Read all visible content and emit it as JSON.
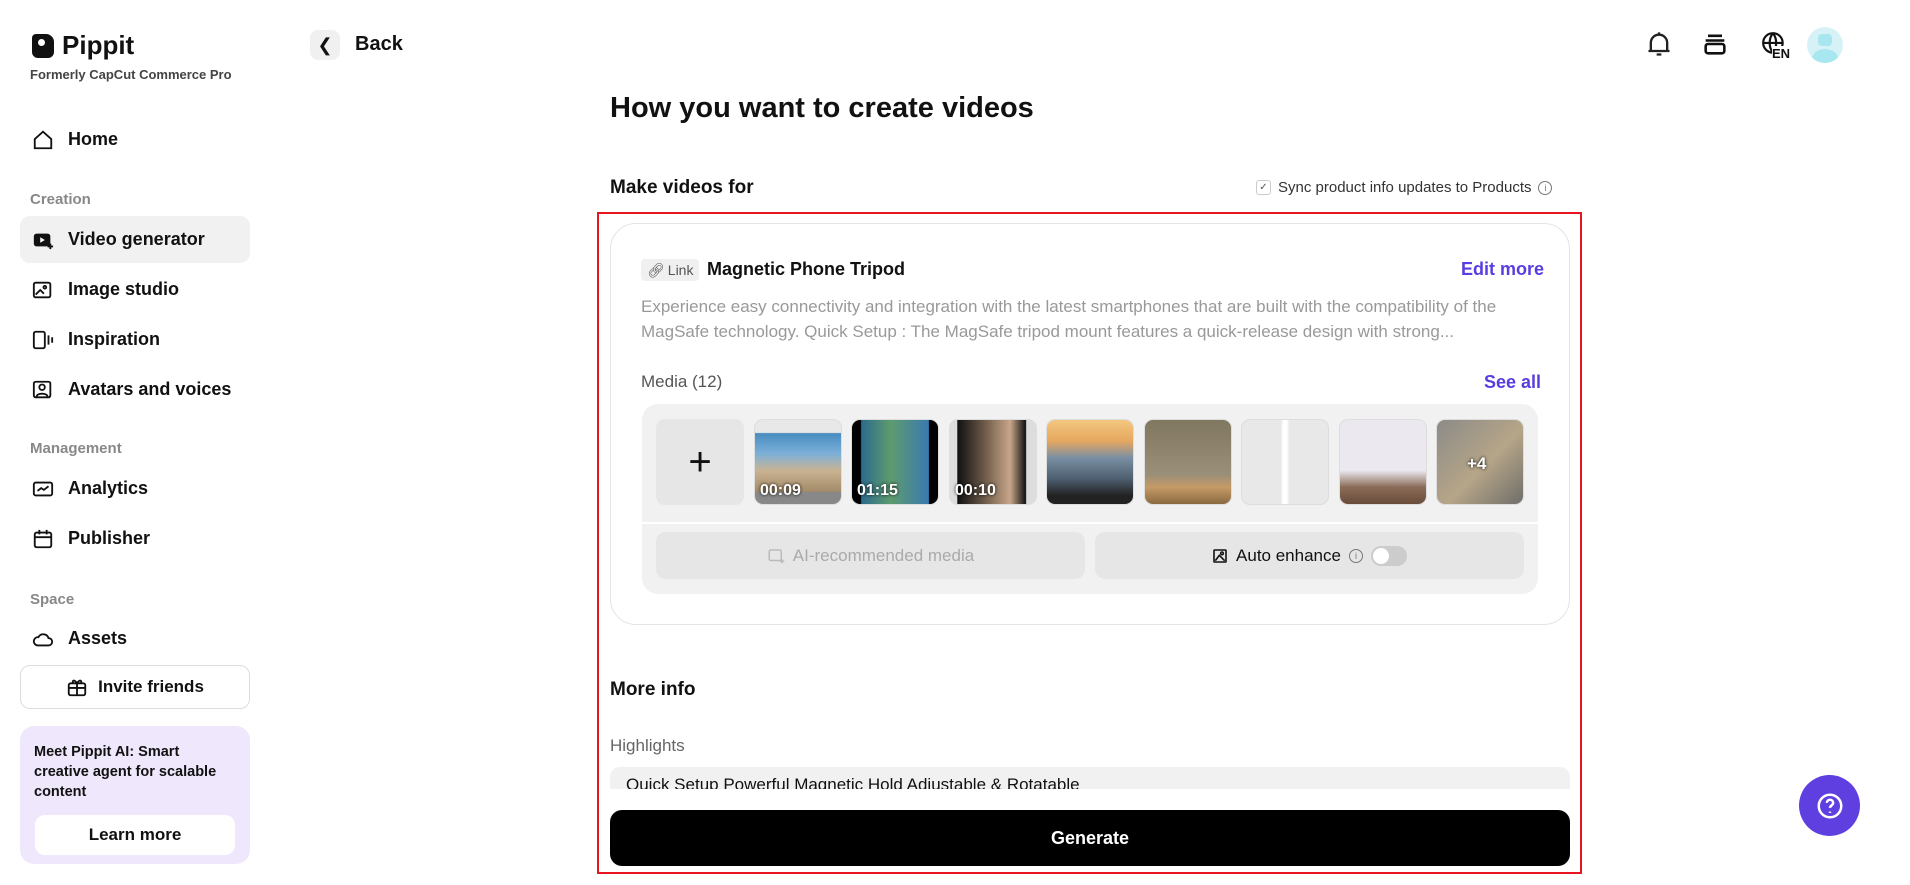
{
  "brand": {
    "name": "Pippit",
    "subtitle": "Formerly CapCut Commerce Pro"
  },
  "sidebar": {
    "home": "Home",
    "sections": [
      "Creation",
      "Management",
      "Space"
    ],
    "creation": [
      "Video generator",
      "Image studio",
      "Inspiration",
      "Avatars and voices"
    ],
    "management": [
      "Analytics",
      "Publisher"
    ],
    "space": [
      "Assets"
    ],
    "invite": "Invite friends",
    "promo": {
      "text": "Meet Pippit AI: Smart creative agent for scalable content",
      "button": "Learn more"
    }
  },
  "header": {
    "back": "Back",
    "language": "EN"
  },
  "main": {
    "title": "How you want to create videos",
    "make_videos_for": "Make videos for",
    "sync_label": "Sync product info updates to Products",
    "sync_checked": true,
    "product": {
      "chip": "Link",
      "name": "Magnetic Phone Tripod",
      "edit": "Edit more",
      "description": "Experience easy connectivity and integration with the latest smartphones that are built with the compatibility of the MagSafe technology. Quick Setup : The MagSafe tripod mount features a quick-release design with strong...",
      "media_label": "Media (12)",
      "see_all": "See all",
      "thumbs": [
        {
          "duration": "00:09"
        },
        {
          "duration": "01:15"
        },
        {
          "duration": "00:10"
        },
        {
          "duration": ""
        },
        {
          "duration": ""
        },
        {
          "duration": ""
        },
        {
          "duration": ""
        },
        {
          "duration": "+4"
        }
      ],
      "ai_media": "AI-recommended media",
      "auto_enhance": "Auto enhance",
      "auto_enhance_on": false
    },
    "more_info": "More info",
    "highlights_label": "Highlights",
    "highlights_value": "Quick Setup Powerful Magnetic Hold Adjustable & Rotatable",
    "generate": "Generate"
  },
  "colors": {
    "accent": "#5a3de0",
    "highlight_box": "#e8141f"
  }
}
